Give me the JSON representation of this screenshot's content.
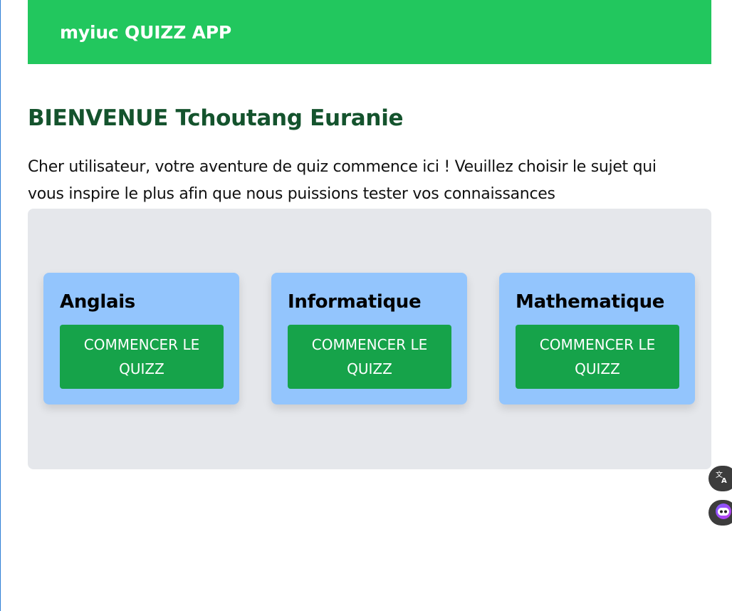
{
  "header": {
    "title": "myiuc QUIZZ APP"
  },
  "welcome": {
    "heading": "BIENVENUE Tchoutang Euranie",
    "text": "Cher utilisateur, votre aventure de quiz commence ici ! Veuillez choisir le sujet qui vous inspire le plus afin que nous puissions tester vos connaissances"
  },
  "quizzes": [
    {
      "subject": "Anglais",
      "button_label": "COMMENCER LE QUIZZ"
    },
    {
      "subject": "Informatique",
      "button_label": "COMMENCER LE QUIZZ"
    },
    {
      "subject": "Mathematique",
      "button_label": "COMMENCER LE QUIZZ"
    }
  ],
  "floating": {
    "translate_icon": "translate-icon",
    "assistant_icon": "assistant-icon"
  },
  "colors": {
    "header_bg": "#22c75e",
    "heading": "#14532d",
    "panel_bg": "#e5e7eb",
    "card_bg": "#93c5fd",
    "button_bg": "#16a34a"
  }
}
